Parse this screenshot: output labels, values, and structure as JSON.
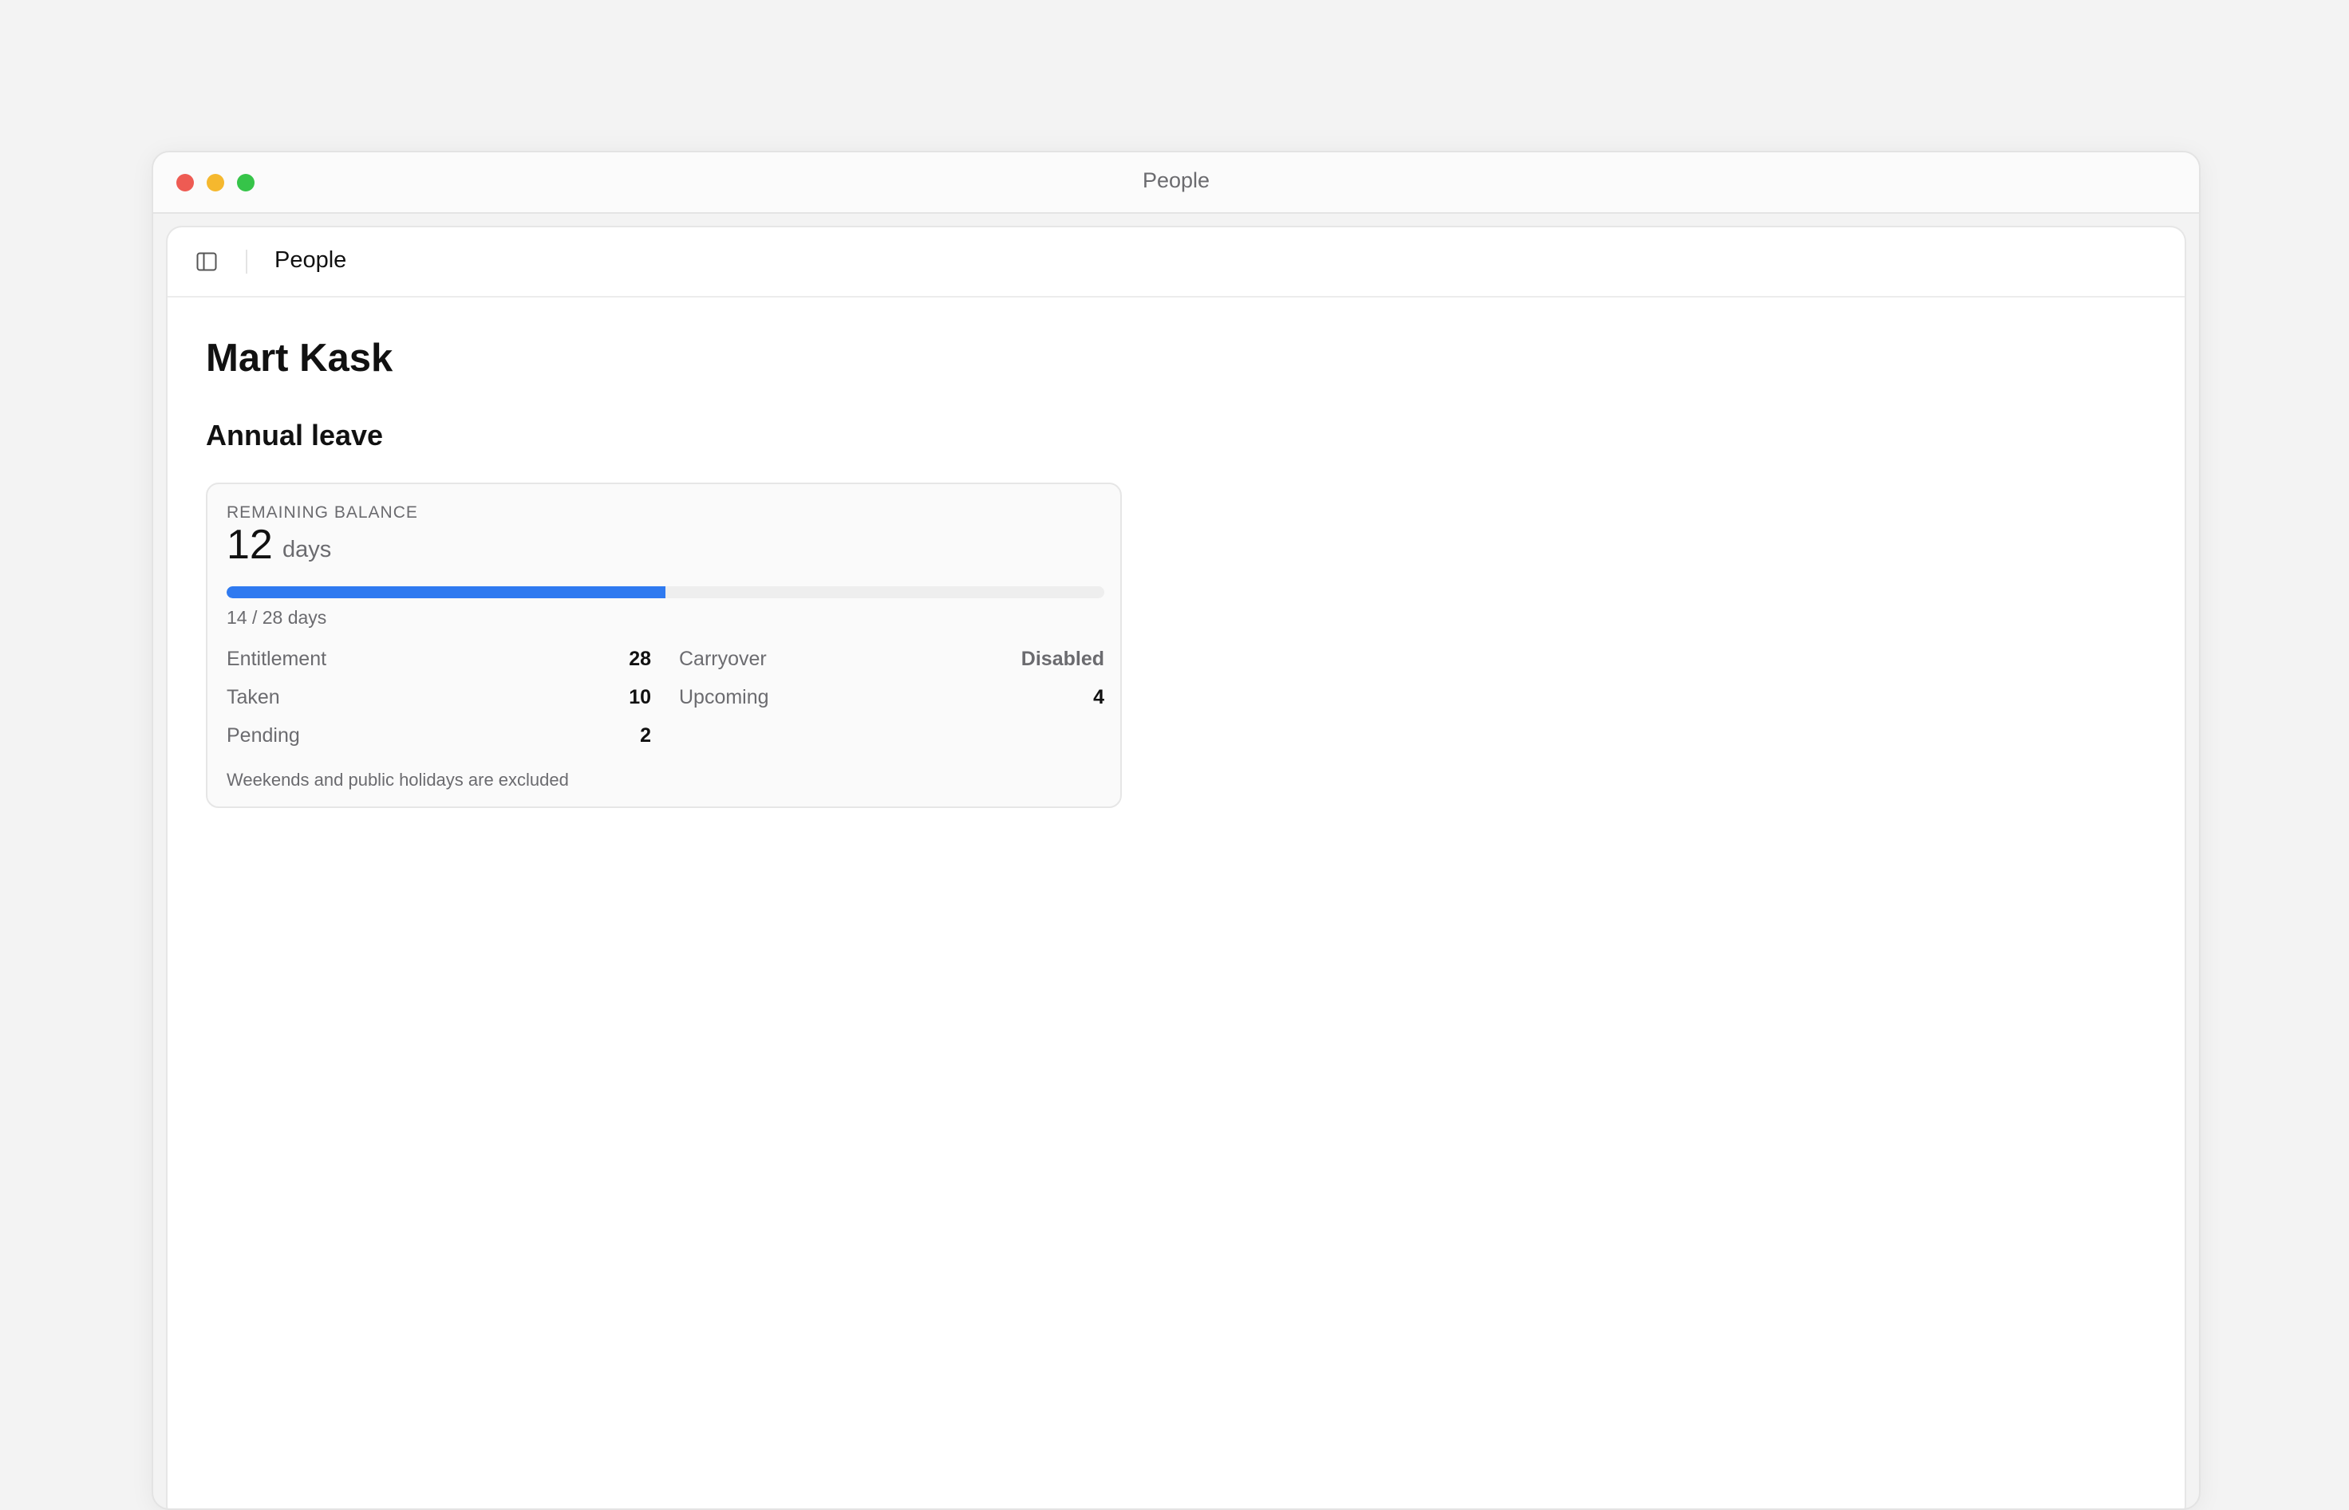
{
  "window": {
    "title": "People"
  },
  "header": {
    "title": "People",
    "toggle_icon": "sidebar-toggle-icon"
  },
  "person": {
    "name": "Mart Kask"
  },
  "annual_leave": {
    "section_title": "Annual leave",
    "balance_label": "REMAINING BALANCE",
    "balance_value": "12",
    "balance_unit": "days",
    "progress_fraction": 0.5,
    "progress_caption": "14 / 28 days",
    "stats": {
      "entitlement": {
        "label": "Entitlement",
        "value": "28"
      },
      "taken": {
        "label": "Taken",
        "value": "10"
      },
      "pending": {
        "label": "Pending",
        "value": "2"
      },
      "carryover": {
        "label": "Carryover",
        "value": "Disabled"
      },
      "upcoming": {
        "label": "Upcoming",
        "value": "4"
      }
    },
    "footnote": "Weekends and public holidays are excluded"
  },
  "colors": {
    "progress_fill": "#2f7af0",
    "traffic_close": "#ee5b53",
    "traffic_minimize": "#f5b82e",
    "traffic_maximize": "#36c449"
  }
}
